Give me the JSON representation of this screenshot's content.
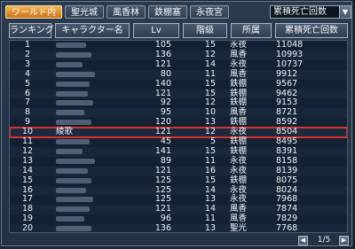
{
  "tabs": [
    {
      "label": "ワールド内",
      "active": true
    },
    {
      "label": "聖光城",
      "active": false
    },
    {
      "label": "風香林",
      "active": false
    },
    {
      "label": "鉄棚塞",
      "active": false
    },
    {
      "label": "永夜宮",
      "active": false
    }
  ],
  "sort_dropdown": {
    "selected": "累積死亡回数"
  },
  "columns": [
    "ランキング",
    "キャラクター名",
    "Lv",
    "階級",
    "所属",
    "累積死亡回数"
  ],
  "rows": [
    {
      "rank": "1",
      "name": "",
      "lv": "105",
      "grade": "15",
      "aff": "永夜",
      "count": "11048"
    },
    {
      "rank": "2",
      "name": "",
      "lv": "136",
      "grade": "12",
      "aff": "風香",
      "count": "10993"
    },
    {
      "rank": "3",
      "name": "",
      "lv": "121",
      "grade": "14",
      "aff": "永夜",
      "count": "10737"
    },
    {
      "rank": "4",
      "name": "",
      "lv": "80",
      "grade": "11",
      "aff": "風香",
      "count": "9912"
    },
    {
      "rank": "5",
      "name": "",
      "lv": "140",
      "grade": "15",
      "aff": "鉄棚",
      "count": "9567"
    },
    {
      "rank": "6",
      "name": "",
      "lv": "121",
      "grade": "15",
      "aff": "鉄棚",
      "count": "9462"
    },
    {
      "rank": "7",
      "name": "",
      "lv": "92",
      "grade": "12",
      "aff": "鉄棚",
      "count": "9153"
    },
    {
      "rank": "8",
      "name": "",
      "lv": "95",
      "grade": "10",
      "aff": "風香",
      "count": "8721"
    },
    {
      "rank": "9",
      "name": "",
      "lv": "120",
      "grade": "13",
      "aff": "鉄棚",
      "count": "8592"
    },
    {
      "rank": "10",
      "name": "綾歌",
      "lv": "121",
      "grade": "12",
      "aff": "永夜",
      "count": "8504"
    },
    {
      "rank": "11",
      "name": "",
      "lv": "45",
      "grade": "5",
      "aff": "鉄棚",
      "count": "8495"
    },
    {
      "rank": "12",
      "name": "",
      "lv": "141",
      "grade": "15",
      "aff": "鉄棚",
      "count": "8391"
    },
    {
      "rank": "13",
      "name": "",
      "lv": "89",
      "grade": "11",
      "aff": "永夜",
      "count": "8158"
    },
    {
      "rank": "14",
      "name": "",
      "lv": "121",
      "grade": "16",
      "aff": "永夜",
      "count": "8139"
    },
    {
      "rank": "15",
      "name": "",
      "lv": "125",
      "grade": "15",
      "aff": "鉄棚",
      "count": "8075"
    },
    {
      "rank": "16",
      "name": "",
      "lv": "125",
      "grade": "14",
      "aff": "永夜",
      "count": "8024"
    },
    {
      "rank": "17",
      "name": "",
      "lv": "125",
      "grade": "13",
      "aff": "永夜",
      "count": "7968"
    },
    {
      "rank": "18",
      "name": "",
      "lv": "121",
      "grade": "14",
      "aff": "風香",
      "count": "7874"
    },
    {
      "rank": "19",
      "name": "",
      "lv": "96",
      "grade": "11",
      "aff": "風香",
      "count": "7829"
    },
    {
      "rank": "20",
      "name": "",
      "lv": "136",
      "grade": "13",
      "aff": "聖光",
      "count": "7768"
    }
  ],
  "highlight_rank": "10",
  "pager": {
    "text": "1/5"
  },
  "colors": {
    "active_tab": "#e0922f",
    "highlight_border": "#d9312d",
    "background": "#1b2430"
  }
}
